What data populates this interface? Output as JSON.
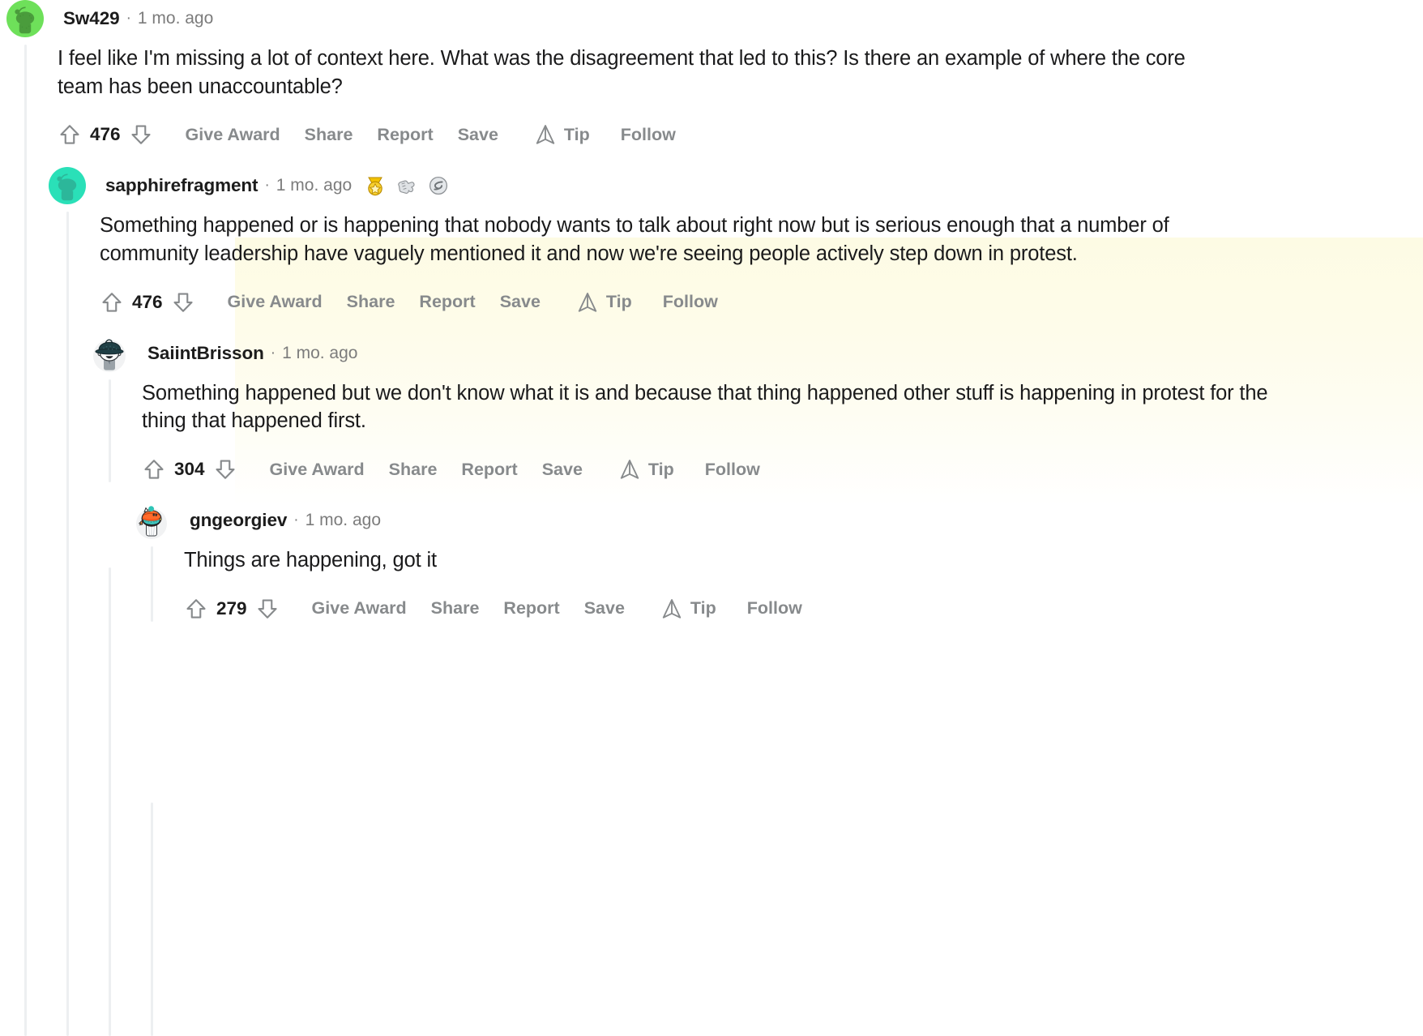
{
  "page": {
    "kind": "reddit-comment-thread",
    "background": "#ffffff",
    "highlight_color": "#fdfbe4",
    "thread_line_color": "#edeff1",
    "text_color": "#1a1a1b",
    "muted_color": "#878a8c"
  },
  "action_labels": {
    "give_award": "Give Award",
    "share": "Share",
    "report": "Report",
    "save": "Save",
    "tip": "Tip",
    "follow": "Follow"
  },
  "icons": {
    "upvote": "upvote-arrow-icon",
    "downvote": "downvote-arrow-icon",
    "tip": "tip-icon",
    "separator": "·"
  },
  "comments": [
    {
      "id": "c0",
      "depth": 0,
      "author": "Sw429",
      "timestamp": "1 mo. ago",
      "separator": "·",
      "body": "I feel like I'm missing a lot of context here. What was the disagreement that led to this? Is there an example of where the core team has been unaccountable?",
      "score": "476",
      "badges": [],
      "avatar": "snoo-green",
      "highlighted": false
    },
    {
      "id": "c1",
      "depth": 1,
      "author": "sapphirefragment",
      "timestamp": "1 mo. ago",
      "separator": "·",
      "body": "Something happened or is happening that nobody wants to talk about right now but is serious enough that a number of community leadership have vaguely mentioned it and now we're seeing people actively step down in protest.",
      "score": "476",
      "badges": [
        "gold-medal-award-icon",
        "silver-hug-award-icon",
        "silver-snoo-award-icon"
      ],
      "avatar": "snoo-teal",
      "highlighted": true
    },
    {
      "id": "c2",
      "depth": 2,
      "author": "SaiintBrisson",
      "timestamp": "1 mo. ago",
      "separator": "·",
      "body": "Something happened but we don't know what it is and because that thing happened other stuff is happening in protest for the thing that happened first.",
      "score": "304",
      "badges": [],
      "avatar": "snoo-bowler-hat",
      "highlighted": false
    },
    {
      "id": "c3",
      "depth": 3,
      "author": "gngeorgiev",
      "timestamp": "1 mo. ago",
      "separator": "·",
      "body": "Things are happening, got it",
      "score": "279",
      "badges": [],
      "avatar": "snoo-orange-helmet",
      "highlighted": false
    }
  ]
}
